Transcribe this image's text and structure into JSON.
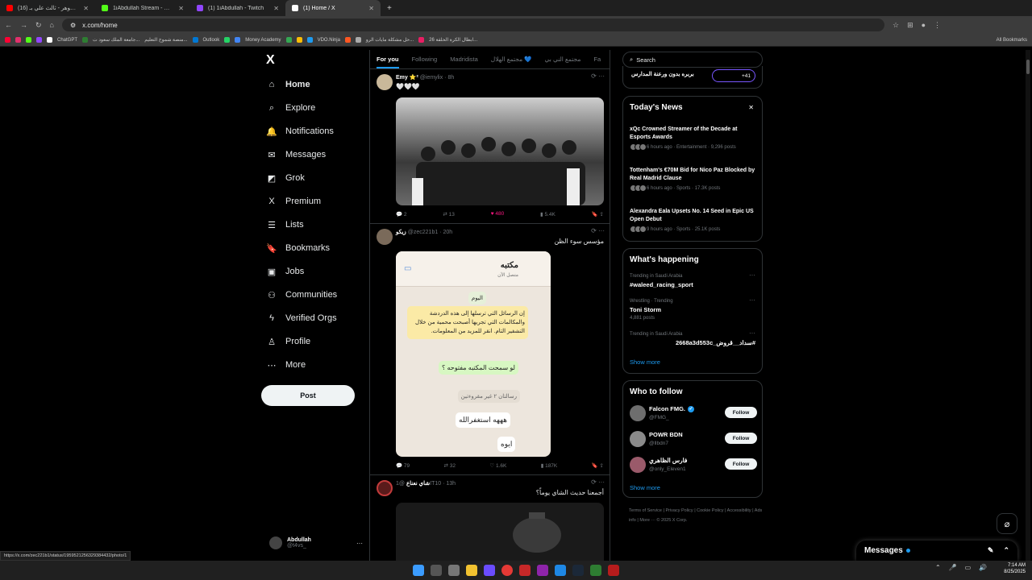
{
  "browser": {
    "tabs": [
      {
        "title": "(16) عيادي الجوهر - ثالث علي بـ",
        "color": "#ff0000",
        "active": false
      },
      {
        "title": "1iAbdullah Stream - Watch",
        "color": "#53fc18",
        "active": false
      },
      {
        "title": "(1) 1iAbdullah - Twitch",
        "color": "#9146ff",
        "active": false
      },
      {
        "title": "(1) Home / X",
        "color": "#ffffff",
        "active": true
      }
    ],
    "new_tab": "+",
    "url": "x.com/home",
    "bookmarks": [
      "ChatGPT",
      "جامعة الملك سعود ت...",
      "منصة شموخ التعليم...",
      "Outlook",
      "Money Academy",
      "VDO.Ninja",
      "حل مشكلة مايات الرو...",
      "ابطال الكرة الحلقة 26...",
      "All Bookmarks"
    ],
    "status_url": "https://x.com/zec221b1/status/1959521256329384432/photo/1"
  },
  "sidebar": {
    "logo": "X",
    "items": [
      {
        "label": "Home",
        "icon": "⌂",
        "bold": true
      },
      {
        "label": "Explore",
        "icon": "⌕"
      },
      {
        "label": "Notifications",
        "icon": "🔔"
      },
      {
        "label": "Messages",
        "icon": "✉"
      },
      {
        "label": "Grok",
        "icon": "◩"
      },
      {
        "label": "Premium",
        "icon": "X"
      },
      {
        "label": "Lists",
        "icon": "☰"
      },
      {
        "label": "Bookmarks",
        "icon": "🔖"
      },
      {
        "label": "Jobs",
        "icon": "▣"
      },
      {
        "label": "Communities",
        "icon": "⚇"
      },
      {
        "label": "Verified Orgs",
        "icon": "ϟ"
      },
      {
        "label": "Profile",
        "icon": "♙"
      },
      {
        "label": "More",
        "icon": "⋯"
      }
    ],
    "post_label": "Post",
    "profile": {
      "name": "Abdullah",
      "handle": "@t4vs_",
      "more": "···"
    }
  },
  "feed": {
    "tabs": [
      "For you",
      "Following",
      "Madridista",
      "مجتمع الهلال 💙",
      "مجتمع الني بي",
      "Fa"
    ],
    "tweets": [
      {
        "name": "Emy ⭐²",
        "handle": "@iemylix · 8h",
        "text": "🤍🤍🤍",
        "actions": {
          "replies": "2",
          "retweets": "13",
          "likes": "480",
          "views": "5.4K"
        }
      },
      {
        "name": "زيكو",
        "handle": "@zec221b1 · 20h",
        "text": "مؤسس سوء الظن",
        "chat": {
          "contact": "مكتبه",
          "status": "متصل الآن",
          "day": "اليوم",
          "notice": "إن الرسائل التي ترسلها إلى هذه الدردشة والمكالمات التي تجريها أصبحت محمية من خلال التشفير التام. انقر للمزيد من المعلومات.",
          "msg1": "لو سمحت المكتبه مفتوحه ؟",
          "unread": "رسالتان ٢ غير مقروءتين",
          "msg2": "هههه استغفرالله",
          "msg3": "ايوه"
        },
        "actions": {
          "replies": "79",
          "retweets": "32",
          "likes": "1.6K",
          "views": "187K"
        }
      },
      {
        "name": "شاي نعناع",
        "handle": "@1IT10 · 13h",
        "text": "أجمعنا حديث الشاي يوماً؟"
      }
    ]
  },
  "right": {
    "search_placeholder": "Search",
    "top_widget": {
      "text": "بربره بدون ورعنة المدارس",
      "count": "+41"
    },
    "news": {
      "title": "Today's News",
      "close": "✕",
      "items": [
        {
          "title": "xQc Crowned Streamer of the Decade at Esports Awards",
          "meta": "6 hours ago · Entertainment · 9,296 posts"
        },
        {
          "title": "Tottenham's €70M Bid for Nico Paz Blocked by Real Madrid Clause",
          "meta": "6 hours ago · Sports · 17.3K posts"
        },
        {
          "title": "Alexandra Eala Upsets No. 14 Seed in Epic US Open Debut",
          "meta": "9 hours ago · Sports · 25.1K posts"
        }
      ]
    },
    "happening": {
      "title": "What's happening",
      "items": [
        {
          "meta": "Trending in Saudi Arabia",
          "name": "#waleed_racing_sport",
          "posts": ""
        },
        {
          "meta": "Wrestling · Trending",
          "name": "Toni Storm",
          "posts": "4,881 posts"
        },
        {
          "meta": "Trending in Saudi Arabia",
          "name": "#سداد__قروض_2668a3d553c",
          "posts": ""
        }
      ],
      "show_more": "Show more"
    },
    "follow": {
      "title": "Who to follow",
      "items": [
        {
          "name": "Falcon FMG.",
          "handle": "@FMG_",
          "verified": true,
          "button": "Follow"
        },
        {
          "name": "POWR BDN",
          "handle": "@llbdn7",
          "verified": false,
          "button": "Follow"
        },
        {
          "name": "فارس الظاهري",
          "handle": "@only_Eleven1",
          "verified": false,
          "button": "Follow"
        }
      ],
      "show_more": "Show more"
    },
    "footer": "Terms of Service | Privacy Policy | Cookie Policy | Accessibility | Ads info | More ··· © 2025 X Corp."
  },
  "messages_dock": {
    "label": "Messages"
  },
  "taskbar": {
    "time": "7:14 AM",
    "date": "8/25/2025"
  },
  "colors": {
    "accent": "#1d9bf0",
    "like": "#f91880",
    "bg": "#000000"
  }
}
